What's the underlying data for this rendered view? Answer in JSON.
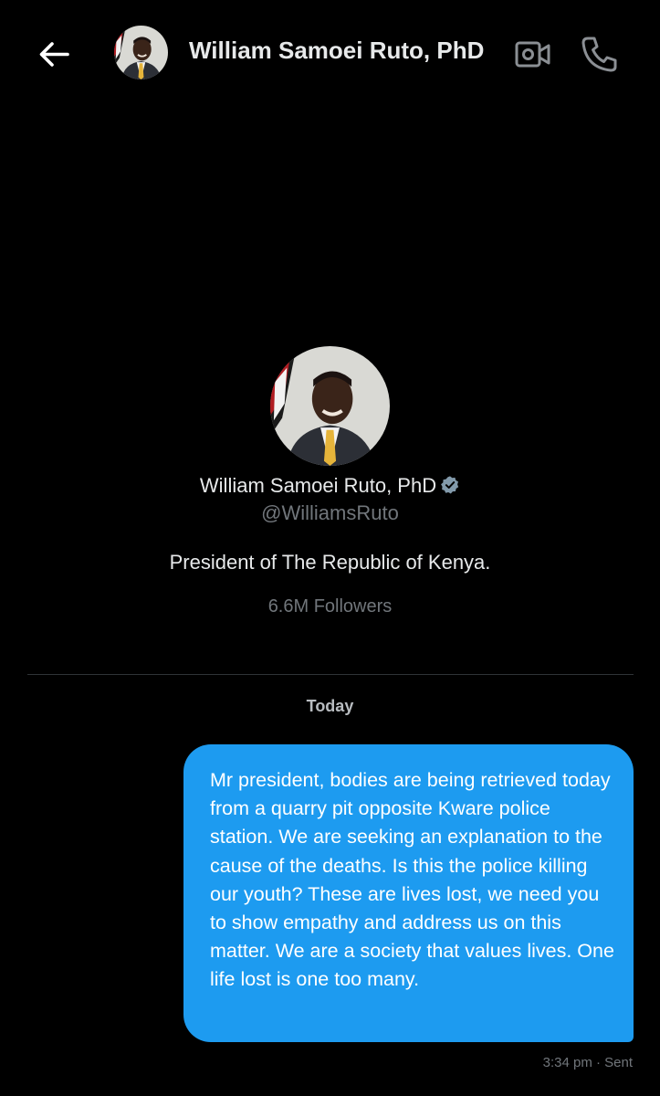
{
  "header": {
    "title": "William Samoei Ruto, PhD",
    "back_icon": "arrow-left-icon",
    "video_icon": "video-camera-icon",
    "call_icon": "phone-icon"
  },
  "profile": {
    "name": "William Samoei Ruto, PhD",
    "handle": "@WilliamsRuto",
    "bio": "President of The Republic of Kenya.",
    "followers": "6.6M Followers",
    "verified_icon": "verified-badge-icon"
  },
  "conversation": {
    "date_separator": "Today",
    "messages": [
      {
        "text": "Mr president, bodies are being retrieved today from a quarry pit opposite Kware police station. We are seeking an explanation to the cause of the deaths. Is this the police killing our youth? These are lives lost, we need you to show empathy and address us on this matter. We are a society that values lives. One life lost is one too many.",
        "time": "3:34 pm",
        "status": "Sent",
        "meta": "3:34 pm · Sent"
      }
    ]
  },
  "colors": {
    "background": "#000000",
    "text_primary": "#e7e9ea",
    "text_secondary": "#71767b",
    "bubble": "#1d9bf0",
    "divider": "#2f3336"
  }
}
